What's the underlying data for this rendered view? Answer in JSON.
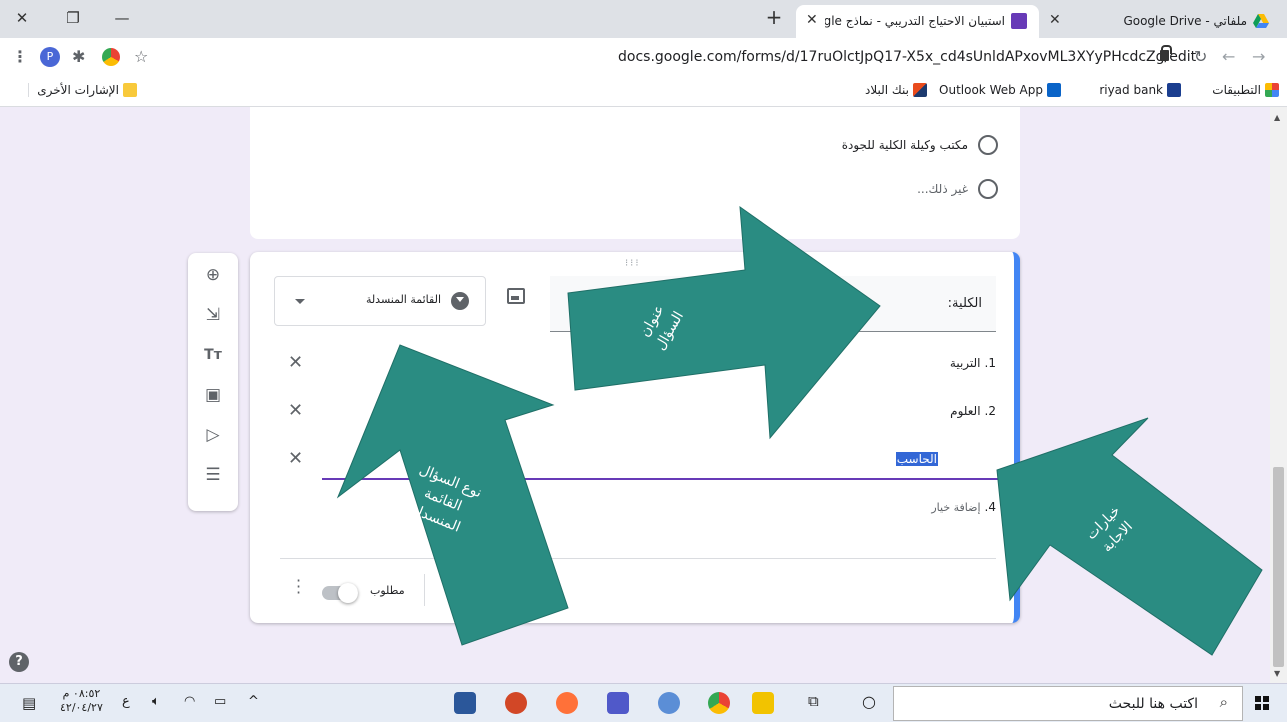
{
  "browser": {
    "tabs": [
      {
        "title": "ملفاتي - Google Drive",
        "active": false
      },
      {
        "title": "استبيان الاحتياج التدريبي - نماذج Google",
        "active": true
      }
    ],
    "new_tab": "+",
    "url": "docs.google.com/forms/d/17ruOlctJpQ17-X5x_cd4sUnldAPxovML3XYyPHcdcZg/edit",
    "bookmarks": [
      "التطبيقات",
      "riyad bank",
      "Outlook Web App",
      "بنك البلاد"
    ],
    "other_bookmarks": "الإشارات الأخرى"
  },
  "form": {
    "prev_options": [
      "مكتب وكيلة الكلية للجودة",
      "غير ذلك..."
    ],
    "question_title": "الكلية:",
    "question_type": "القائمة المنسدلة",
    "options": [
      {
        "num": "1.",
        "text": "التربية"
      },
      {
        "num": "2.",
        "text": "العلوم"
      },
      {
        "num": "",
        "text": "الحاسب"
      }
    ],
    "add_option": {
      "num": "4.",
      "text": "إضافة خيار"
    },
    "required_label": "مطلوب",
    "drag_handle": "⁝⁝⁝"
  },
  "annotations": {
    "title_arrow": "عنوان\nالسؤال",
    "type_arrow": "نوع السؤال\nالقائمة\nالمنسدلة",
    "options_arrow": "خيارات\nالاجابة"
  },
  "taskbar": {
    "search_placeholder": "اكتب هنا للبحث",
    "time": "٠٨:٥٢ م",
    "date": "٤٢/٠٤/٢٧",
    "lang": "ع"
  },
  "colors": {
    "form_bg": "#f0ebf8",
    "accent": "#4285f4",
    "purple": "#673ab7",
    "annotation": "#2a8c82"
  }
}
